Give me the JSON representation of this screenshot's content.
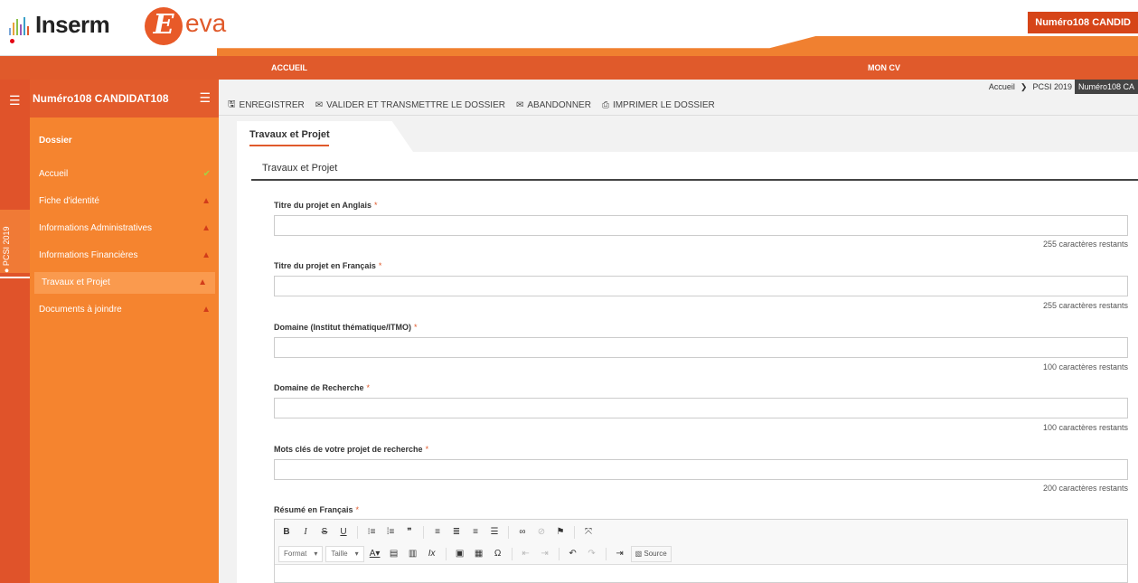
{
  "header": {
    "logo_text": "Inserm",
    "app_letter": "E",
    "app_name": "eva",
    "user_button": "Numéro108 CANDID",
    "brand_color": "#e05a2b"
  },
  "nav": {
    "accueil": "ACCUEIL",
    "cv": "MON CV"
  },
  "breadcrumb": {
    "home": "Accueil",
    "section": "PCSI 2019",
    "current": "Numéro108 CA"
  },
  "sidebar": {
    "user_name": "Numéro108 CANDIDAT108",
    "side_tag": "PCSI 2019",
    "section_title": "Dossier",
    "items": [
      {
        "label": "Accueil",
        "status": "ok"
      },
      {
        "label": "Fiche d'identité",
        "status": "warning"
      },
      {
        "label": "Informations Administratives",
        "status": "warning"
      },
      {
        "label": "Informations Financières",
        "status": "warning"
      },
      {
        "label": "Travaux et Projet",
        "status": "warning",
        "active": true
      },
      {
        "label": "Documents à joindre",
        "status": "warning"
      }
    ]
  },
  "toolbar": {
    "save": "ENREGISTRER",
    "validate": "VALIDER ET TRANSMETTRE LE DOSSIER",
    "abandon": "ABANDONNER",
    "print": "IMPRIMER LE DOSSIER"
  },
  "tab": {
    "label": "Travaux et Projet"
  },
  "panel": {
    "title": "Travaux et Projet",
    "fields": [
      {
        "label": "Titre du projet en Anglais",
        "value": "",
        "counter": "255 caractères restants"
      },
      {
        "label": "Titre du projet en Français",
        "value": "",
        "counter": "255 caractères restants"
      },
      {
        "label": "Domaine (Institut thématique/ITMO)",
        "value": "",
        "counter": "100 caractères restants"
      },
      {
        "label": "Domaine de Recherche",
        "value": "",
        "counter": "100 caractères restants"
      },
      {
        "label": "Mots clés de votre projet de recherche",
        "value": "",
        "counter": "200 caractères restants"
      }
    ],
    "summary_label": "Résumé en Français",
    "required_mark": "*"
  },
  "editor": {
    "format_label": "Format",
    "size_label": "Taille",
    "source_label": "Source"
  }
}
